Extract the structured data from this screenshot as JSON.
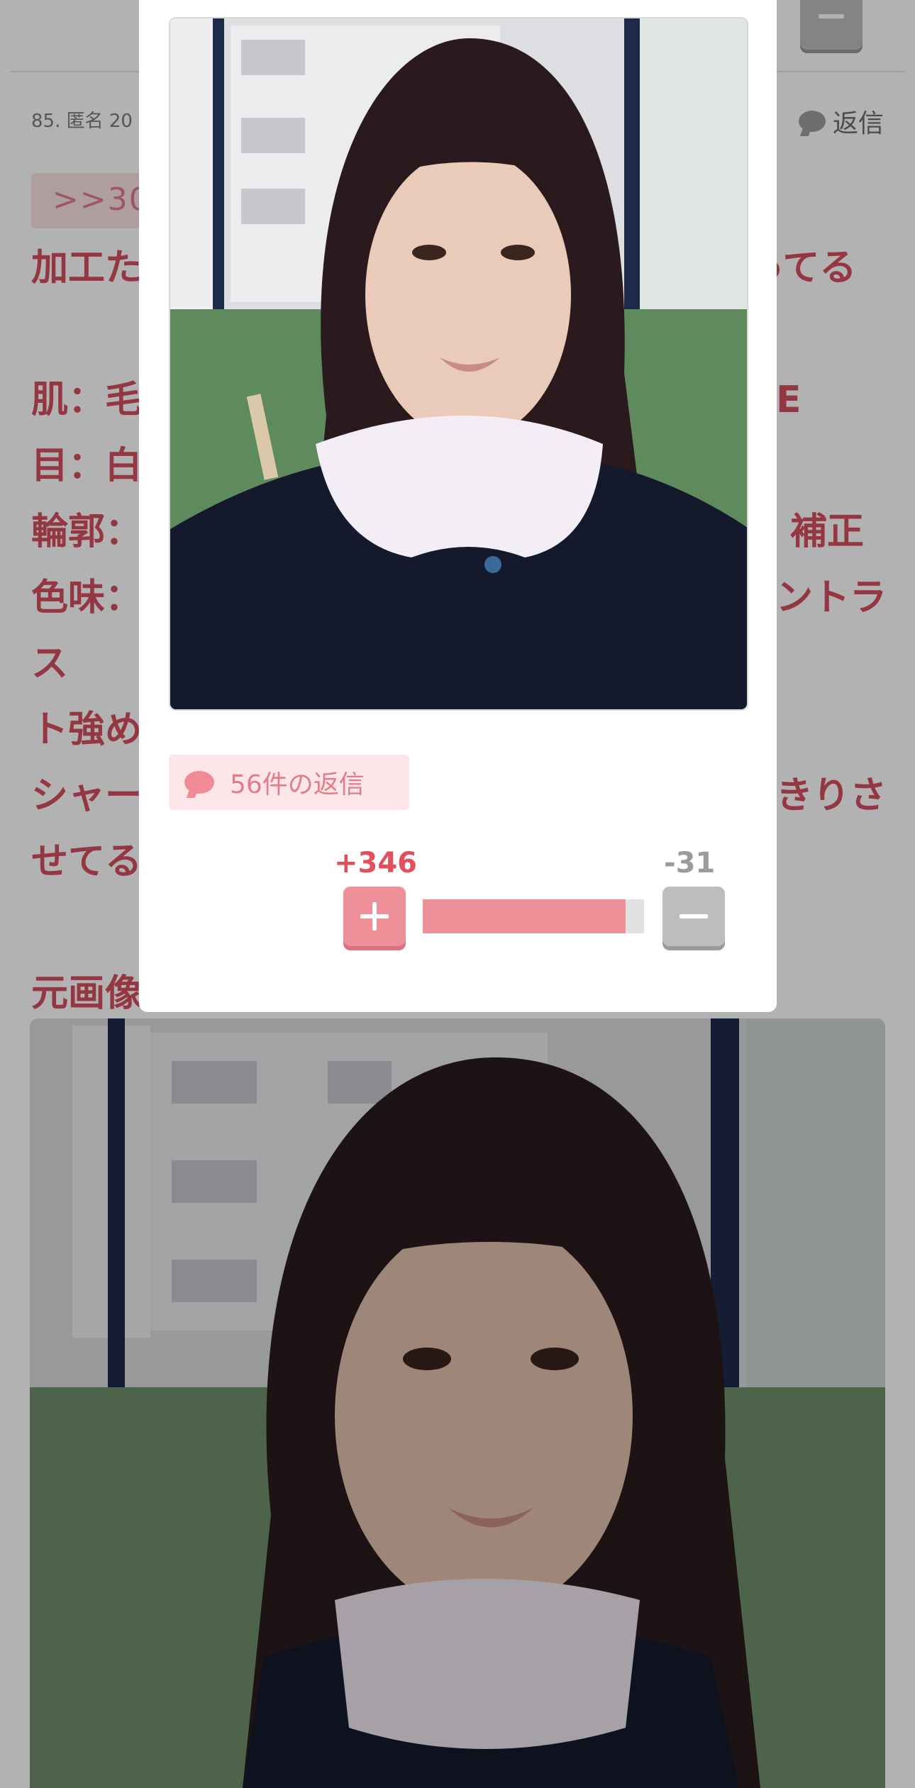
{
  "comment": {
    "meta": "85. 匿名 20",
    "reply_label": "返信",
    "anchor": ">>30",
    "body_lines": [
      "加工た",
      "ってる",
      "",
      "肌：毛",
      "E",
      "目：白",
      "輪郭：",
      "補正",
      "色味：",
      "ントラ",
      "ス",
      "ト強め",
      "シャー",
      "きりさ",
      "せてる",
      "",
      "元画像"
    ]
  },
  "popup": {
    "reply_count_label": "56件の返信",
    "plus_count": "+346",
    "minus_count": "-31",
    "plus_ratio": 0.918
  },
  "colors": {
    "accent_pink": "#ef8f98",
    "text_red": "#d4505f",
    "grey_button": "#bdbdbd"
  },
  "icons": [
    "speech-bubble-icon",
    "plus-icon",
    "minus-icon"
  ]
}
